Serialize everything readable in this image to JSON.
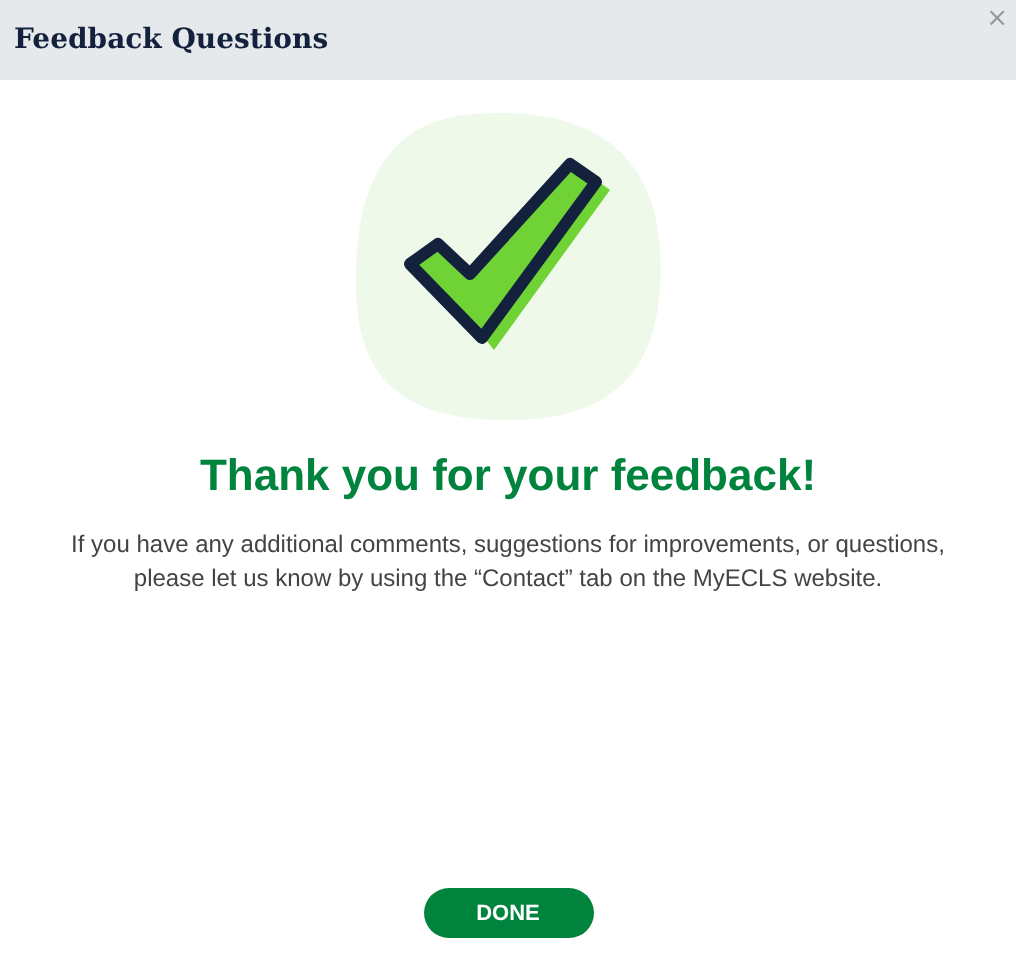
{
  "window": {
    "title": "Feedback Questions",
    "close": "×"
  },
  "heading": "Thank you for your feedback!",
  "message_lines": [
    "If you have any additional comments, suggestions for improvements, or questions,",
    "please let us know by using the “Contact” tab on the MyECLS website."
  ],
  "buttons": [
    "DONE"
  ]
}
